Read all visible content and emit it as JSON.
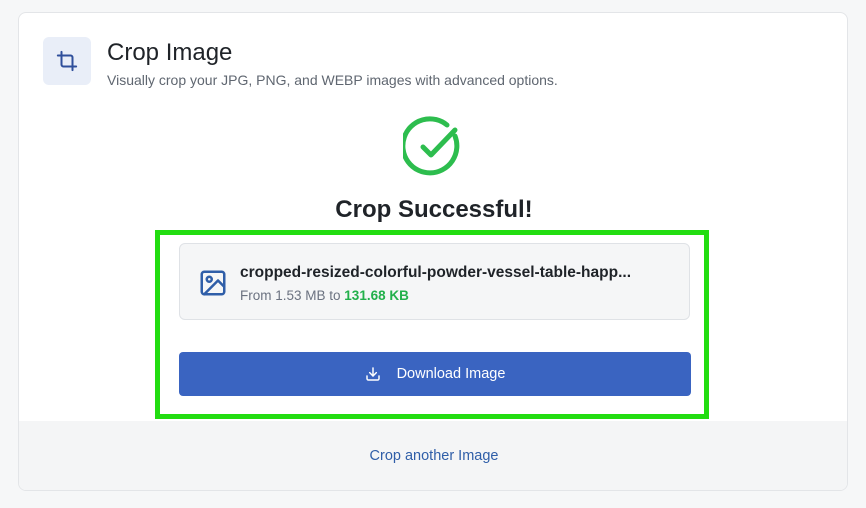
{
  "header": {
    "title": "Crop Image",
    "subtitle": "Visually crop your JPG, PNG, and WEBP images with advanced options.",
    "icon": "crop-icon"
  },
  "result": {
    "status_icon": "check-circle-icon",
    "title": "Crop Successful!",
    "file": {
      "icon": "image-icon",
      "name": "cropped-resized-colorful-powder-vessel-table-happ...",
      "size_prefix": "From 1.53 MB to ",
      "new_size": "131.68 KB"
    },
    "download": {
      "icon": "download-icon",
      "label": "Download Image"
    }
  },
  "footer": {
    "link_label": "Crop another Image"
  },
  "colors": {
    "accent": "#3a64c1",
    "success": "#22b04b",
    "highlight": "#22dd11"
  }
}
